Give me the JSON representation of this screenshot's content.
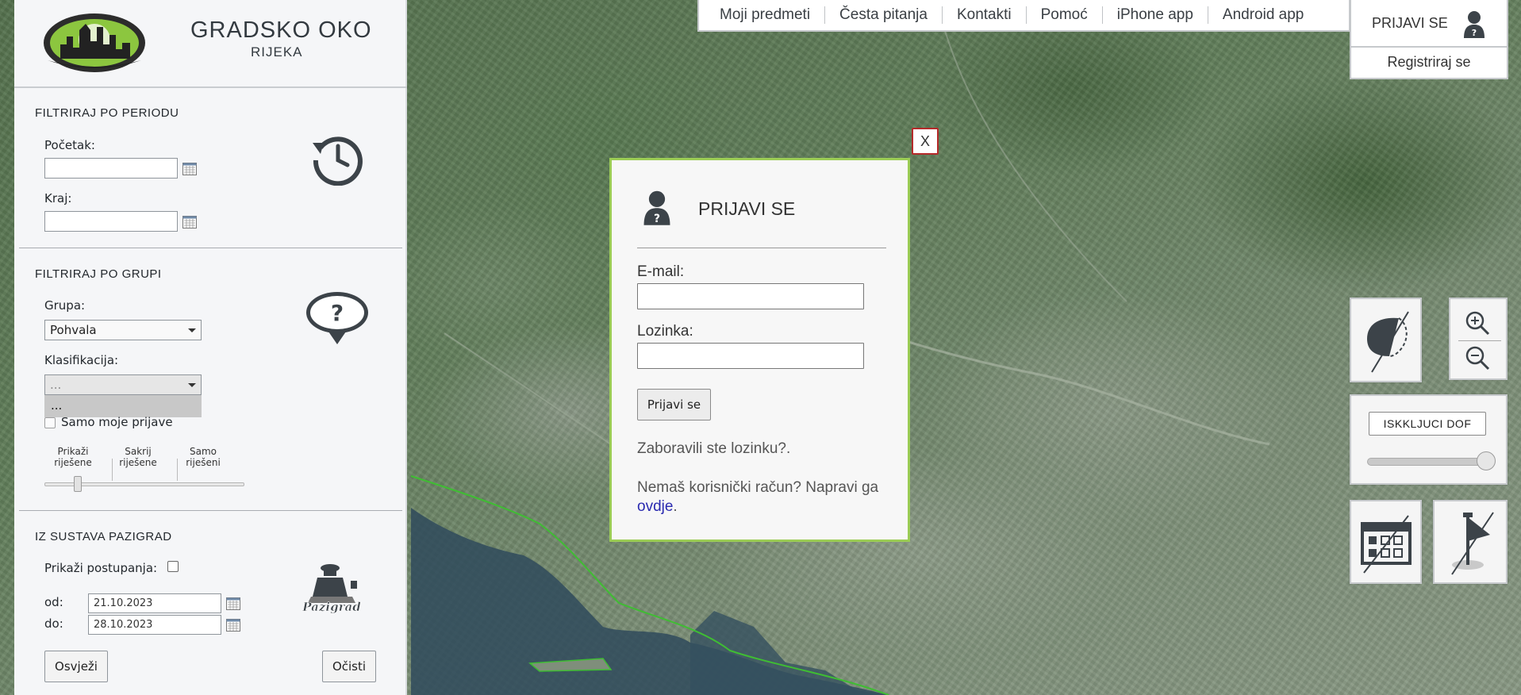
{
  "brand": {
    "title": "GRADSKO OKO",
    "subtitle": "RIJEKA"
  },
  "colors": {
    "accent_green": "#9bcc55",
    "close_border": "#b42a2a",
    "link": "#2a2ab0",
    "panel_bg": "#f5f6f8"
  },
  "filter_period": {
    "title": "FILTRIRAJ PO PERIODU",
    "start_label": "Početak:",
    "start_value": "",
    "end_label": "Kraj:",
    "end_value": "",
    "icon": "history-clock-icon"
  },
  "filter_group": {
    "title": "FILTRIRAJ PO GRUPI",
    "group_label": "Grupa:",
    "group_value": "Pohvala",
    "classification_label": "Klasifikacija:",
    "classification_value": "...",
    "classification_open_option": "...",
    "only_mine_label": "Samo moje prijave",
    "icon": "question-pin-icon",
    "slider_labels": [
      "Prikaži riješene",
      "Sakrij riješene",
      "Samo riješeni"
    ]
  },
  "pazigrad": {
    "title": "IZ SUSTAVA PAZIGRAD",
    "show_actions_label": "Prikaži postupanja:",
    "from_label": "od:",
    "from_value": "21.10.2023",
    "to_label": "do:",
    "to_value": "28.10.2023",
    "logo_text": "Pazigrad",
    "refresh_label": "Osvježi",
    "clear_label": "Očisti"
  },
  "topnav": {
    "items": [
      "Moji predmeti",
      "Česta pitanja",
      "Kontakti",
      "Pomoć",
      "iPhone app",
      "Android app"
    ]
  },
  "account": {
    "login_label": "PRIJAVI SE",
    "register_label": "Registriraj se"
  },
  "login_modal": {
    "close_label": "X",
    "title": "PRIJAVI SE",
    "email_label": "E-mail:",
    "email_value": "",
    "password_label": "Lozinka:",
    "password_value": "",
    "submit_label": "Prijavi se",
    "forgot_text": "Zaboravili ste lozinku?.",
    "signup_text": "Nemaš korisnički račun? Napravi ga",
    "signup_link": "ovdje",
    "signup_end": "."
  },
  "map_controls": {
    "dof_label": "ISKKLJUCI DOF",
    "dof_level": 1.0
  }
}
